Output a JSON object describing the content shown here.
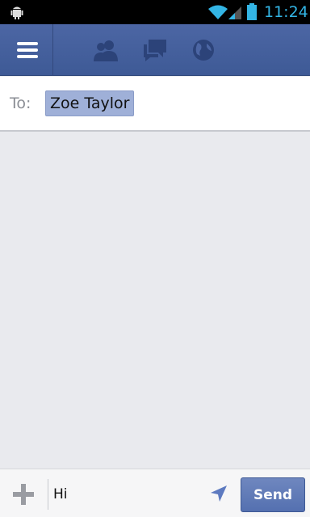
{
  "status_bar": {
    "time": "11:24",
    "icons": [
      "android-debug-icon",
      "wifi-icon",
      "signal-icon",
      "battery-icon"
    ],
    "time_color": "#33b5e5"
  },
  "top_nav": {
    "icons": [
      "menu-icon",
      "friends-icon",
      "messages-icon",
      "globe-icon"
    ],
    "background": "#4c66a4"
  },
  "to_row": {
    "label": "To:",
    "recipient": "Zoe Taylor"
  },
  "compose": {
    "message_value": "Hi",
    "send_label": "Send",
    "icons": [
      "plus-icon",
      "location-arrow-icon"
    ]
  }
}
